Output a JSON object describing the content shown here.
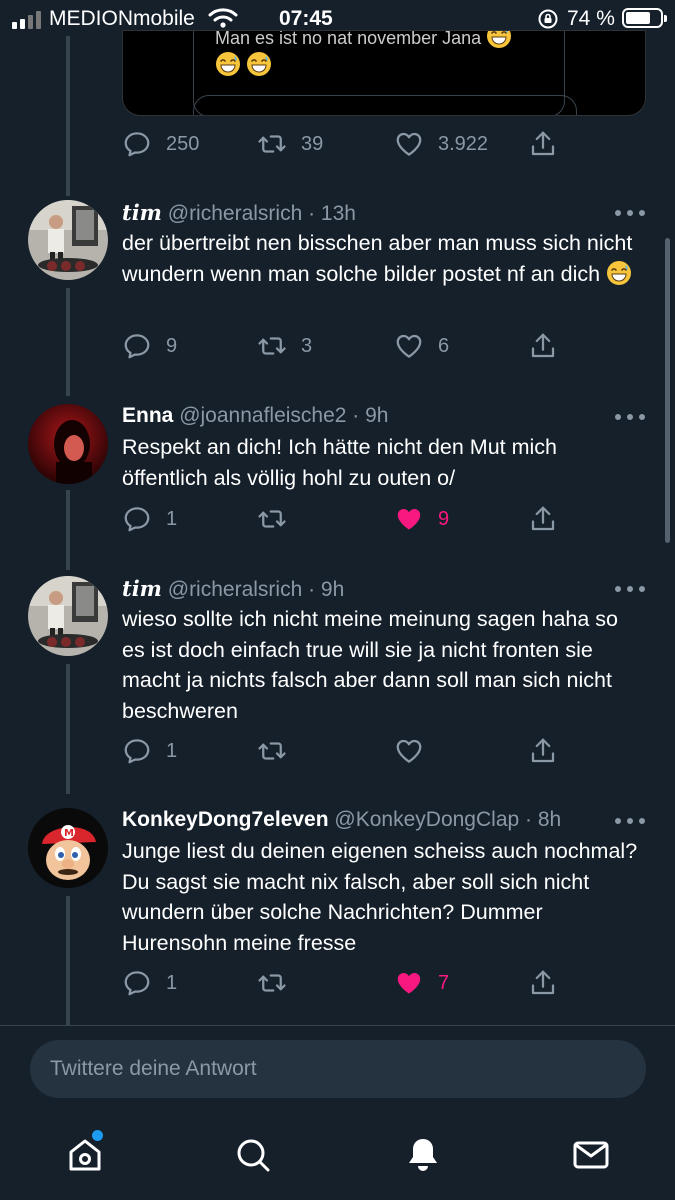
{
  "status_bar": {
    "carrier": "MEDIONmobile",
    "time": "07:45",
    "battery_percent": "74 %",
    "battery_level": 0.74
  },
  "embed": {
    "partial_text": "Man es ist no nat november Jana"
  },
  "top_actions": {
    "replies": "250",
    "retweets": "39",
    "likes": "3.922"
  },
  "tweets": [
    {
      "display_name": "tim",
      "handle": "@richeralsrich",
      "time": "· 13h",
      "text": "der übertreibt nen bisschen aber man muss sich nicht wundern wenn man solche bilder postet nf an dich",
      "replies": "9",
      "retweets": "3",
      "likes": "6",
      "liked": false
    },
    {
      "display_name": "Enna",
      "handle": "@joannafleische2",
      "time": "· 9h",
      "text": "Respekt an dich! Ich hätte nicht den Mut mich öffentlich als völlig hohl zu outen o/",
      "replies": "1",
      "retweets": "",
      "likes": "9",
      "liked": true
    },
    {
      "display_name": "tim",
      "handle": "@richeralsrich",
      "time": "· 9h",
      "text": "wieso sollte ich nicht meine meinung sagen haha so es ist doch einfach true will sie ja nicht fronten sie macht ja nichts falsch aber dann soll man sich nicht beschweren",
      "replies": "1",
      "retweets": "",
      "likes": "",
      "liked": false
    },
    {
      "display_name": "KonkeyDong7eleven",
      "handle": "@KonkeyDongClap",
      "time": "· 8h",
      "text": "Junge liest du deinen eigenen scheiss auch nochmal? Du sagst sie macht nix falsch, aber soll sich nicht wundern über solche Nachrichten? Dummer Hurensohn meine fresse",
      "replies": "1",
      "retweets": "",
      "likes": "7",
      "liked": true
    }
  ],
  "reply_box": {
    "placeholder": "Twittere deine Antwort"
  },
  "colors": {
    "background": "#15202b",
    "secondary_text": "#8b98a5",
    "like": "#f91880",
    "accent": "#1d9bf0"
  },
  "icons": [
    "reply-icon",
    "retweet-icon",
    "heart-icon",
    "share-icon",
    "home-icon",
    "search-icon",
    "bell-icon",
    "mail-icon"
  ]
}
